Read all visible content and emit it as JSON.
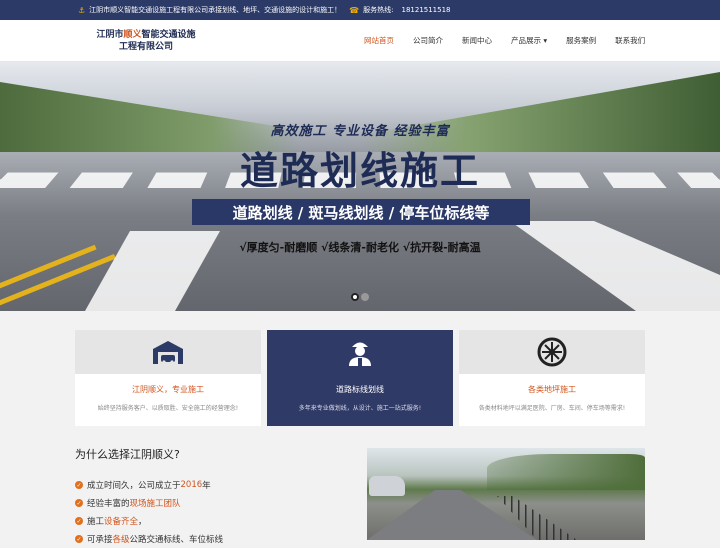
{
  "topbar": {
    "intro": "江阴市顺义智能交通设施工程有限公司承接划线、地坪、交通设施的设计和施工！",
    "hotline_label": "服务热线:",
    "hotline": "18121511518"
  },
  "logo": {
    "line1_a": "江阴市",
    "line1_red": "顺义",
    "line1_b": "智能交通设施",
    "line2": "工程有限公司"
  },
  "nav": [
    {
      "label": "网站首页",
      "active": true
    },
    {
      "label": "公司简介"
    },
    {
      "label": "新闻中心"
    },
    {
      "label": "产品展示 ▾"
    },
    {
      "label": "服务案例"
    },
    {
      "label": "联系我们"
    }
  ],
  "hero": {
    "slogan": "高效施工 专业设备 经验丰富",
    "title": "道路划线施工",
    "band": "道路划线  /  斑马线划线  /  停车位标线等",
    "features": "√厚度匀-耐磨顺   √线条清-耐老化   √抗开裂-耐高温"
  },
  "services": [
    {
      "icon": "garage-icon",
      "title": "江阴顺义，专业施工",
      "desc": "始终坚持服务客户、以质取胜、安全施工的经营理念!"
    },
    {
      "icon": "worker-icon",
      "title": "道路标线划线",
      "desc": "多年来专业做划线，从设计、施工一站式服务!"
    },
    {
      "icon": "wheel-icon",
      "title": "各类地坪施工",
      "desc": "各类材料地坪以满足医院、厂房、车间、停车场等需求!"
    }
  ],
  "why": {
    "heading": "为什么选择江阴顺义?",
    "items": [
      {
        "a": "成立时间久，公司成立于",
        "hl": "2016",
        "b": "年"
      },
      {
        "a": "经验丰富的",
        "hl": "现场施工团队",
        "b": ""
      },
      {
        "a": "施工",
        "hl": "设备齐全",
        "b": "，"
      },
      {
        "a": "可承接",
        "hl": "各级",
        "b": "公路交通标线、车位标线"
      }
    ]
  }
}
